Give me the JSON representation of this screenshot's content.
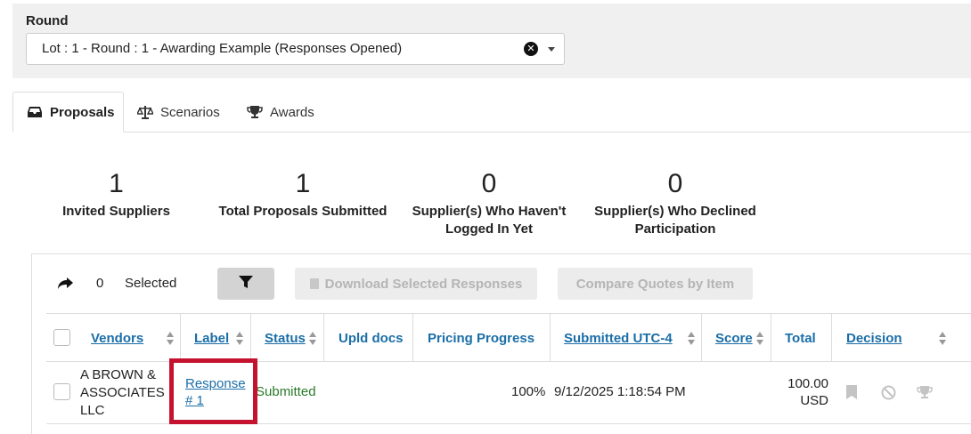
{
  "round": {
    "label": "Round",
    "selected": "Lot : 1 - Round : 1 - Awarding Example (Responses Opened)"
  },
  "tabs": [
    {
      "label": "Proposals",
      "icon": "inbox-icon",
      "active": true
    },
    {
      "label": "Scenarios",
      "icon": "balance-scale-icon",
      "active": false
    },
    {
      "label": "Awards",
      "icon": "trophy-icon",
      "active": false
    }
  ],
  "stats": [
    {
      "value": "1",
      "label_lines": [
        "Invited Suppliers"
      ]
    },
    {
      "value": "1",
      "label_lines": [
        "Total Proposals Submitted"
      ]
    },
    {
      "value": "0",
      "label_lines": [
        "Supplier(s) Who Haven't",
        "Logged In Yet"
      ]
    },
    {
      "value": "0",
      "label_lines": [
        "Supplier(s) Who Declined",
        "Participation"
      ]
    }
  ],
  "toolbar": {
    "selected_count": "0",
    "selected_label": "Selected",
    "download_label": "Download Selected Responses",
    "compare_label": "Compare Quotes by Item"
  },
  "table": {
    "headers": {
      "vendors": "Vendors",
      "label": "Label",
      "status": "Status",
      "upld_docs": "Upld docs",
      "pricing_progress": "Pricing Progress",
      "submitted": "Submitted UTC-4",
      "score": "Score",
      "total": "Total",
      "decision": "Decision"
    },
    "rows": [
      {
        "vendor_lines": [
          "A BROWN &",
          "ASSOCIATES",
          "LLC"
        ],
        "label_lines": [
          "Response",
          "# 1"
        ],
        "status": "Submitted",
        "upld_docs": "",
        "pricing_progress": "100%",
        "submitted": "9/12/2025 1:18:54 PM",
        "score": "",
        "total_lines": [
          "100.00",
          "USD"
        ]
      }
    ]
  },
  "colors": {
    "link": "#1a6ea8",
    "status_submitted": "#2a7a2a",
    "highlight": "#c4122f"
  }
}
